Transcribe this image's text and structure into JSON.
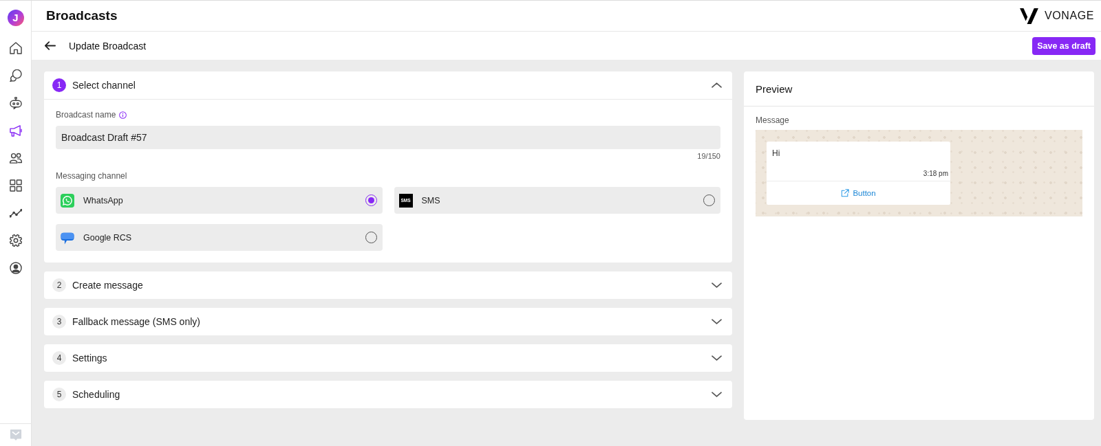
{
  "sidebar": {
    "logo": "J",
    "items": [
      {
        "kind": "home",
        "selected": false
      },
      {
        "kind": "chat",
        "selected": false
      },
      {
        "kind": "bot",
        "selected": false
      },
      {
        "kind": "megaphone",
        "selected": true
      },
      {
        "kind": "people",
        "selected": false
      },
      {
        "kind": "grid",
        "selected": false
      },
      {
        "kind": "trend",
        "selected": false
      },
      {
        "kind": "gear",
        "selected": false
      },
      {
        "kind": "account",
        "selected": false
      }
    ]
  },
  "header": {
    "title": "Broadcasts",
    "brand": "VONAGE"
  },
  "subheader": {
    "title": "Update Broadcast",
    "save_button": "Save as draft"
  },
  "steps": [
    {
      "number": "1",
      "title": "Select channel",
      "expanded": true,
      "form": {
        "name_label": "Broadcast name",
        "name_value": "Broadcast Draft #57",
        "counter": "19/150",
        "channel_label": "Messaging channel",
        "channels": [
          {
            "kind": "whatsapp",
            "label": "WhatsApp",
            "selected": true
          },
          {
            "kind": "sms",
            "label": "SMS",
            "badge": "SMS",
            "selected": false
          },
          {
            "kind": "rcs",
            "label": "Google RCS",
            "selected": false
          }
        ]
      }
    },
    {
      "number": "2",
      "title": "Create message",
      "expanded": false
    },
    {
      "number": "3",
      "title": "Fallback message (SMS only)",
      "expanded": false
    },
    {
      "number": "4",
      "title": "Settings",
      "expanded": false
    },
    {
      "number": "5",
      "title": "Scheduling",
      "expanded": false
    }
  ],
  "preview": {
    "title": "Preview",
    "label": "Message",
    "bubble": {
      "text": "Hi",
      "time": "3:18 pm",
      "button": "Button"
    }
  }
}
